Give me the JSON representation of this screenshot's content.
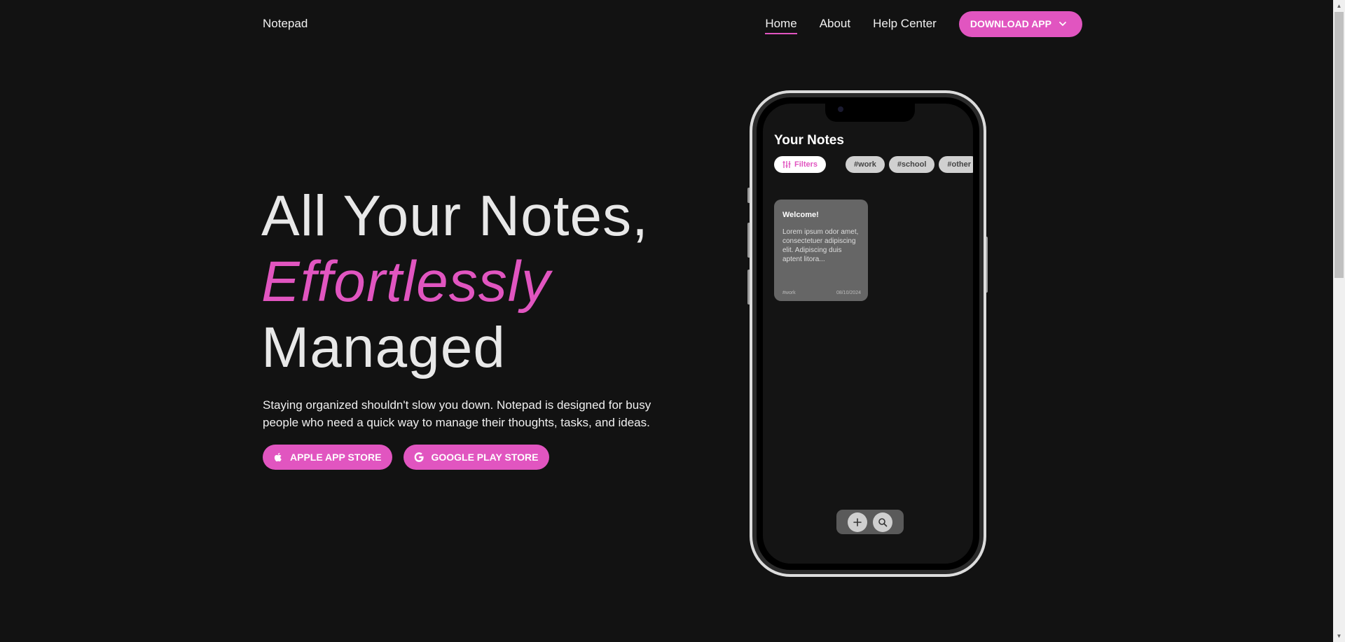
{
  "nav": {
    "brand": "Notepad",
    "links": [
      {
        "label": "Home",
        "active": true
      },
      {
        "label": "About"
      },
      {
        "label": "Help Center"
      }
    ],
    "download_label": "DOWNLOAD APP"
  },
  "hero": {
    "line1": "All Your Notes,",
    "line2": "Effortlessly",
    "line3": "Managed",
    "description": "Staying organized shouldn't slow you down. Notepad is designed for busy people who need a quick way to manage their thoughts, tasks, and ideas.",
    "apple_label": "APPLE APP STORE",
    "google_label": "GOOGLE PLAY STORE"
  },
  "phone": {
    "title": "Your Notes",
    "filters_label": "Filters",
    "tags": [
      "#work",
      "#school",
      "#other"
    ],
    "note": {
      "title": "Welcome!",
      "body": "Lorem ipsum odor amet, consectetuer adipiscing elit. Adipiscing duis aptent litora...",
      "tag": "#work",
      "date": "08/10/2024"
    }
  },
  "colors": {
    "accent": "#e155c0",
    "background": "#121212"
  }
}
